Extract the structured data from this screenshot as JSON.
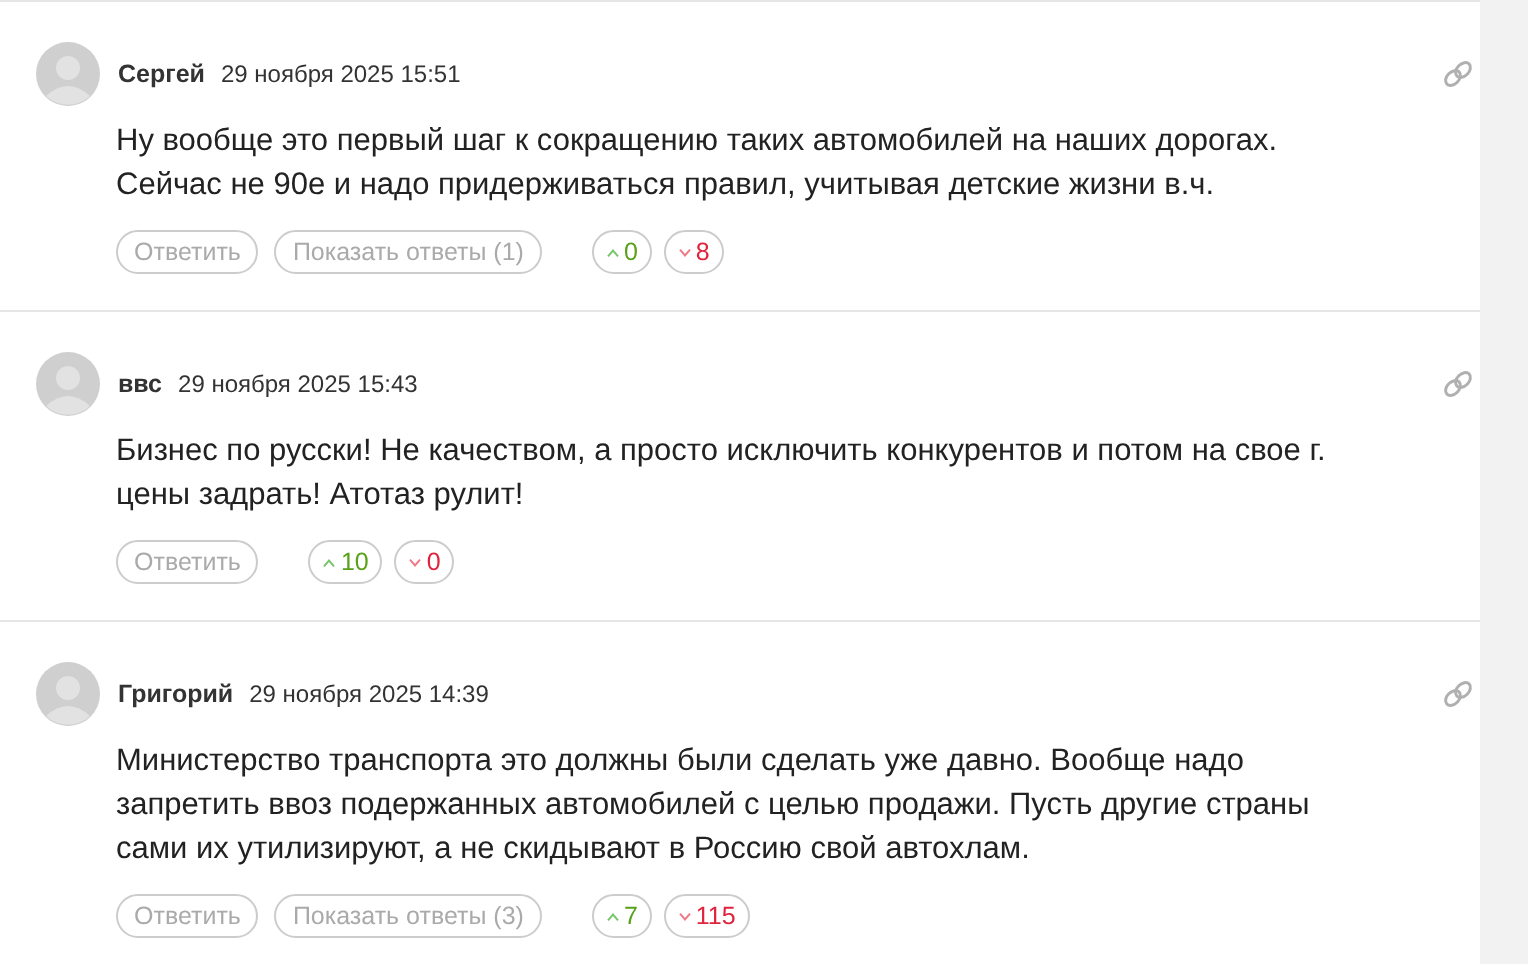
{
  "comments": [
    {
      "author": "Сергей",
      "date": "29 ноября 2025 15:51",
      "text": "Ну вообще это первый шаг к сокращению таких автомобилей на наших дорогах.\nСейчас не 90е и надо придерживаться правил, учитывая детские жизни в.ч.",
      "reply": "Ответить",
      "show_replies": "Показать ответы (1)",
      "likes": "0",
      "dislikes": "8"
    },
    {
      "author": "ввс",
      "date": "29 ноября 2025 15:43",
      "text": "Бизнес по русски! Не качеством, а просто исключить конкурентов и потом на свое г.\nцены задрать! Атотаз рулит!",
      "reply": "Ответить",
      "likes": "10",
      "dislikes": "0"
    },
    {
      "author": "Григорий",
      "date": "29 ноября 2025 14:39",
      "text": "Министерство транспорта это должны были сделать уже давно. Вообще надо\nзапретить ввоз подержанных автомобилей с целью продажи. Пусть другие страны\nсами их утилизируют, а не скидывают в Россию свой автохлам.",
      "reply": "Ответить",
      "show_replies": "Показать ответы (3)",
      "likes": "7",
      "dislikes": "115"
    }
  ]
}
